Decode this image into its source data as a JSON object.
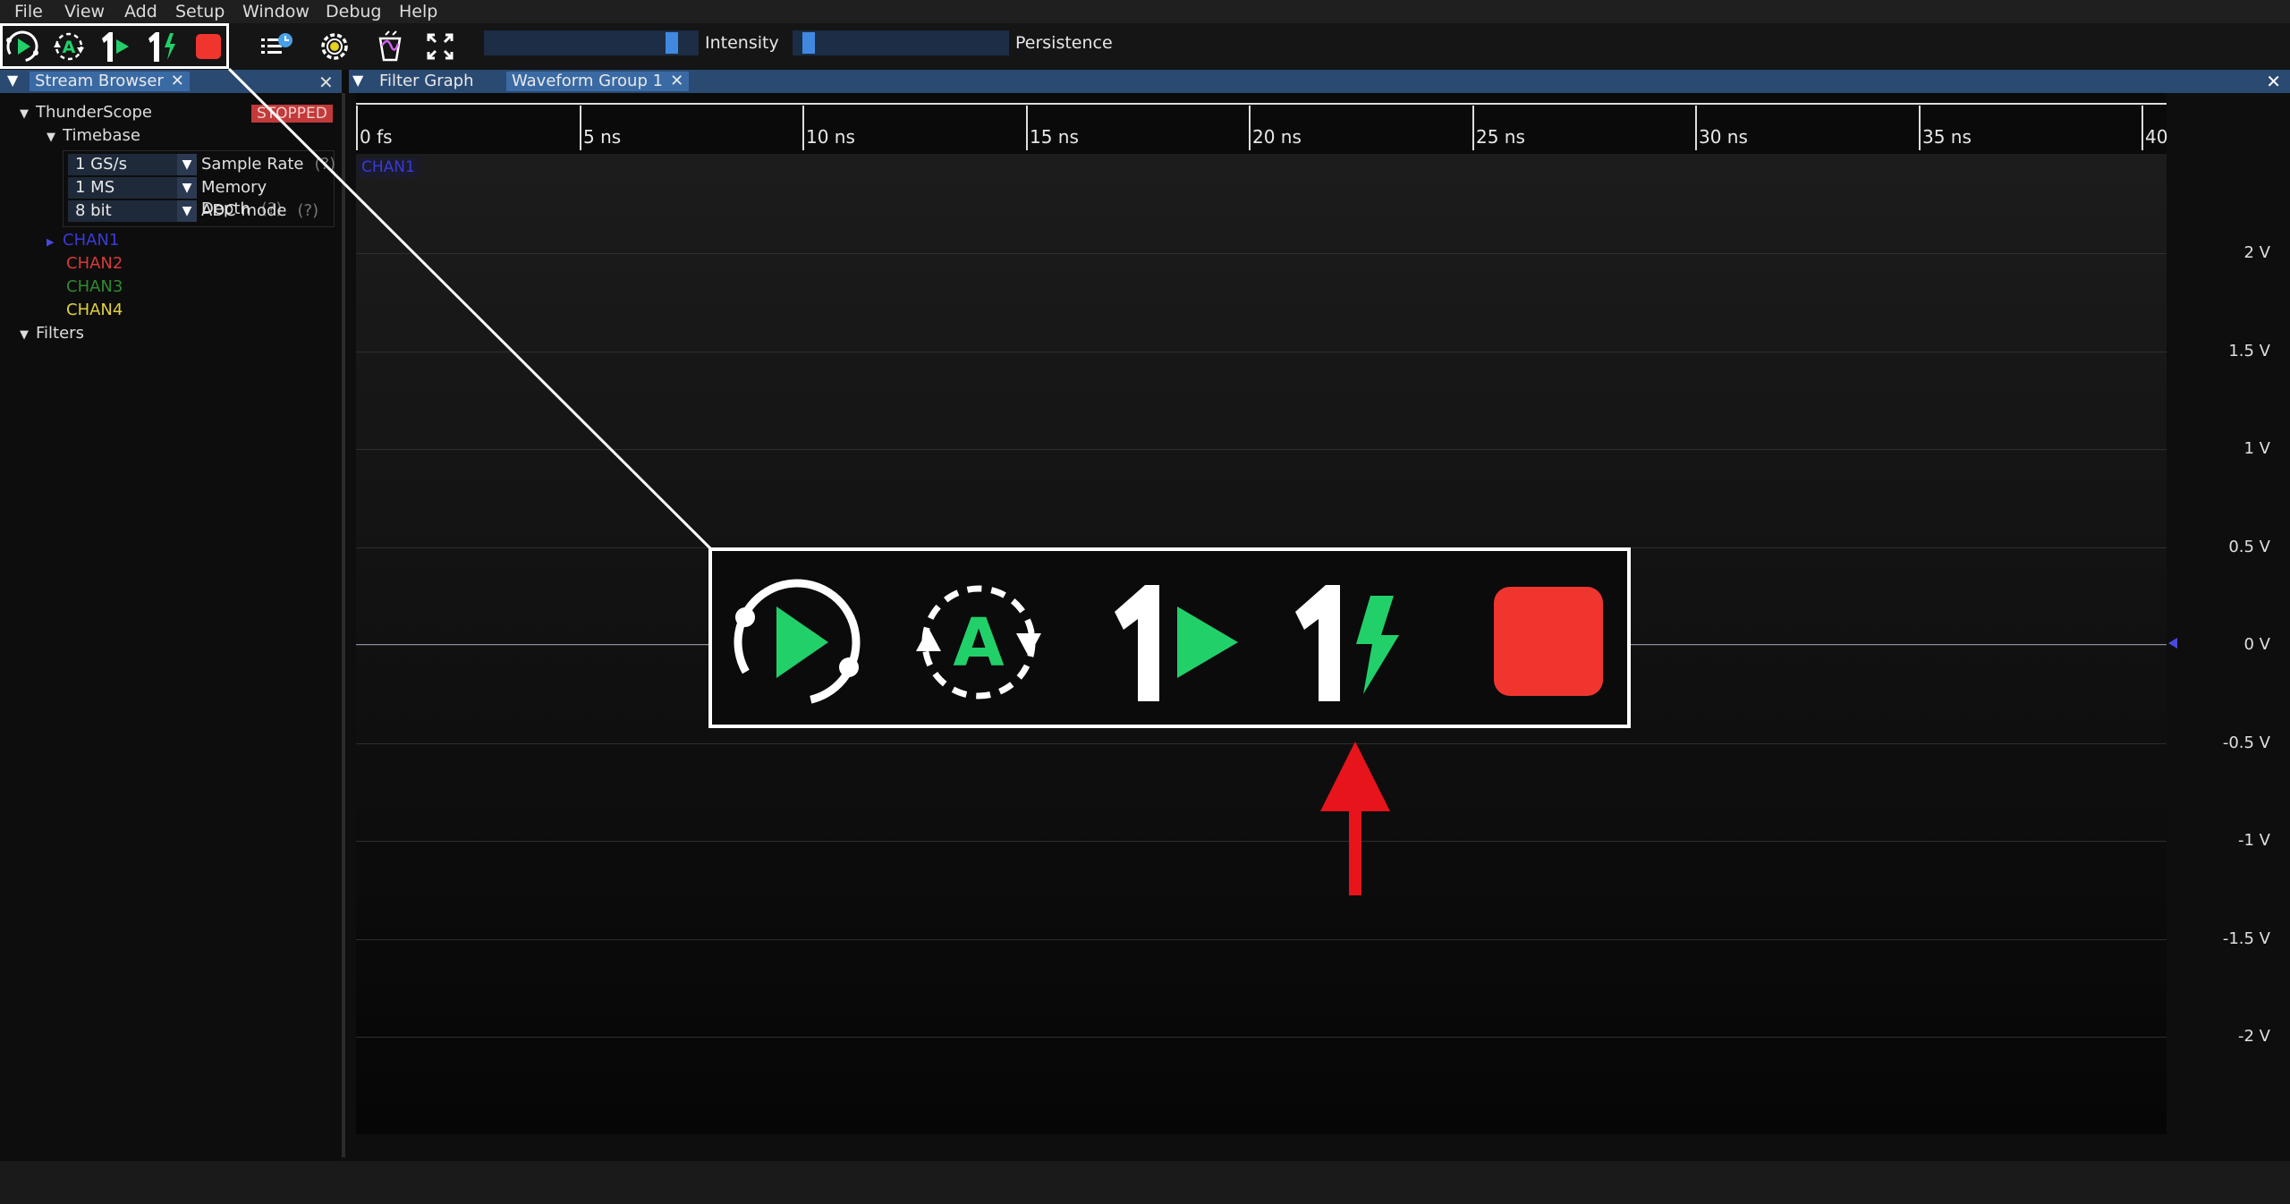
{
  "menu": [
    "File",
    "View",
    "Add",
    "Setup",
    "Window",
    "Debug",
    "Help"
  ],
  "toolbar": {
    "buttons": [
      "trigger-run-icon",
      "auto-trigger-icon",
      "single-trigger-icon",
      "force-trigger-icon",
      "stop-trigger-icon",
      "history-icon",
      "preferences-icon",
      "clear-sweeps-icon",
      "fullscreen-icon"
    ],
    "intensity_label": "Intensity",
    "intensity_value": 0.9,
    "persistence_label": "Persistence",
    "persistence_value": 0.05
  },
  "left_tabs": {
    "active": "Stream Browser"
  },
  "right_tabs": {
    "tab1": "Filter Graph",
    "tab2": "Waveform Group 1"
  },
  "stream_browser": {
    "instrument": "ThunderScope",
    "status": "STOPPED",
    "timebase": "Timebase",
    "sample_rate": "1 GS/s",
    "sample_rate_label": "Sample Rate",
    "memory_depth": "1 MS",
    "memory_depth_label": "Memory Depth",
    "adc_mode": "8 bit",
    "adc_mode_label": "ADC mode",
    "help": "(?)",
    "channels": [
      {
        "name": "CHAN1",
        "color": "#3a3ad6"
      },
      {
        "name": "CHAN2",
        "color": "#d63a3a"
      },
      {
        "name": "CHAN3",
        "color": "#2f8a2f"
      },
      {
        "name": "CHAN4",
        "color": "#e0d040"
      }
    ],
    "filters": "Filters"
  },
  "waveform": {
    "channel_tag": "CHAN1",
    "x_ticks": [
      "0 fs",
      "5 ns",
      "10 ns",
      "15 ns",
      "20 ns",
      "25 ns",
      "30 ns",
      "35 ns",
      "40"
    ],
    "y_ticks": [
      "2 V",
      "1.5 V",
      "1 V",
      "0.5 V",
      "0 V",
      "-0.5 V",
      "-1 V",
      "-1.5 V",
      "-2 V"
    ]
  },
  "colors": {
    "trigger_green": "#22d06a",
    "stop_red": "#f0352f",
    "annotation_arrow": "#e8141b"
  }
}
